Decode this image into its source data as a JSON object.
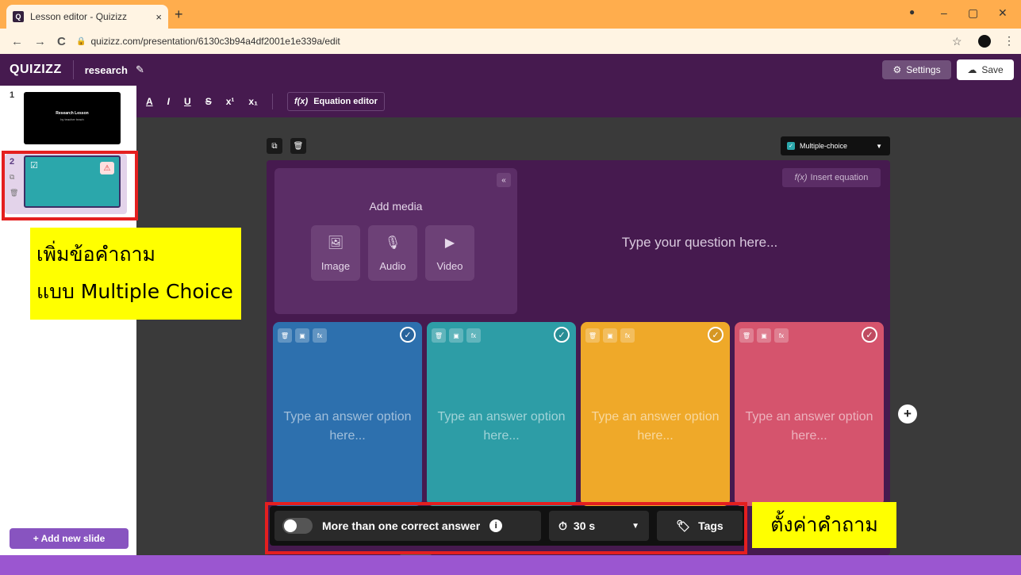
{
  "browser": {
    "tab_title": "Lesson editor - Quizizz",
    "tab_close": "×",
    "new_tab": "+",
    "url": "quizizz.com/presentation/6130c3b94a4df2001e1e339a/edit",
    "back": "←",
    "forward": "→",
    "reload": "C",
    "star": "☆",
    "menu": "⋮",
    "minimize": "–",
    "maximize": "▢",
    "close": "✕"
  },
  "app": {
    "logo": "QUIZIZZ",
    "lesson_name": "research",
    "settings_label": "Settings",
    "save_label": "Save"
  },
  "sidebar": {
    "slides": [
      {
        "number": "1",
        "title": "Research Lesson",
        "subtitle": "by teacher teach"
      },
      {
        "number": "2"
      }
    ],
    "add_slide_label": "+ Add new slide"
  },
  "toolbar": {
    "items": [
      "A",
      "I",
      "U",
      "S",
      "x¹",
      "x₁"
    ],
    "equation_label": "Equation editor",
    "equation_icon": "f(x)"
  },
  "editor": {
    "question_type": "Multiple-choice",
    "add_media_label": "Add media",
    "media_buttons": [
      "Image",
      "Audio",
      "Video"
    ],
    "insert_equation_label": "Insert equation",
    "question_placeholder": "Type your question here...",
    "answers": [
      {
        "placeholder": "Type an answer option here...",
        "color": "#2d70ae"
      },
      {
        "placeholder": "Type an answer option here...",
        "color": "#2d9da6"
      },
      {
        "placeholder": "Type an answer option here...",
        "color": "#efa929"
      },
      {
        "placeholder": "Type an answer option here...",
        "color": "#d5546d"
      }
    ]
  },
  "bottom": {
    "multi_correct_label": "More than one correct answer",
    "timer_label": "30 s",
    "tags_label": "Tags"
  },
  "annotations": {
    "left_line1": "เพิ่มข้อคำถาม",
    "left_line2": "แบบ Multiple Choice",
    "right": "ตั้งค่าคำถาม"
  },
  "colors": {
    "brand_purple": "#461a4f",
    "accent_purple": "#8854c0",
    "highlight_red": "#e41f1f",
    "highlight_yellow": "#ffff00"
  }
}
